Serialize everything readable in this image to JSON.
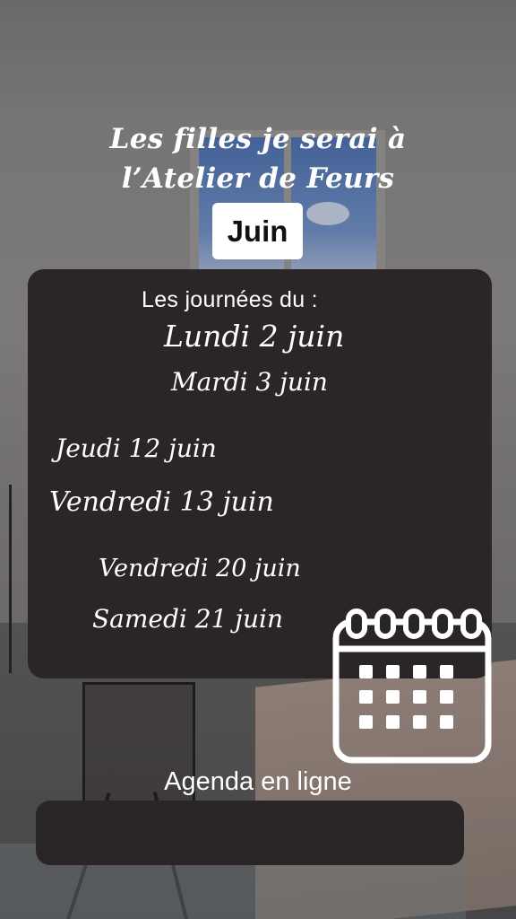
{
  "story": {
    "title_line1": "Les filles je serai à",
    "title_line2": "l’Atelier de Feurs",
    "month_badge": "Juin",
    "intro": "Les journées du :",
    "days": [
      "Lundi 2 juin",
      "Mardi 3 juin",
      "Jeudi 12 juin",
      "Vendredi 13 juin",
      "Vendredi 20 juin",
      "Samedi 21 juin"
    ],
    "agenda_label": "Agenda en ligne",
    "icon": "calendar-icon"
  },
  "colors": {
    "panel": "#2a2526",
    "text": "#ffffff",
    "badge_bg": "#ffffff",
    "badge_text": "#111111"
  }
}
